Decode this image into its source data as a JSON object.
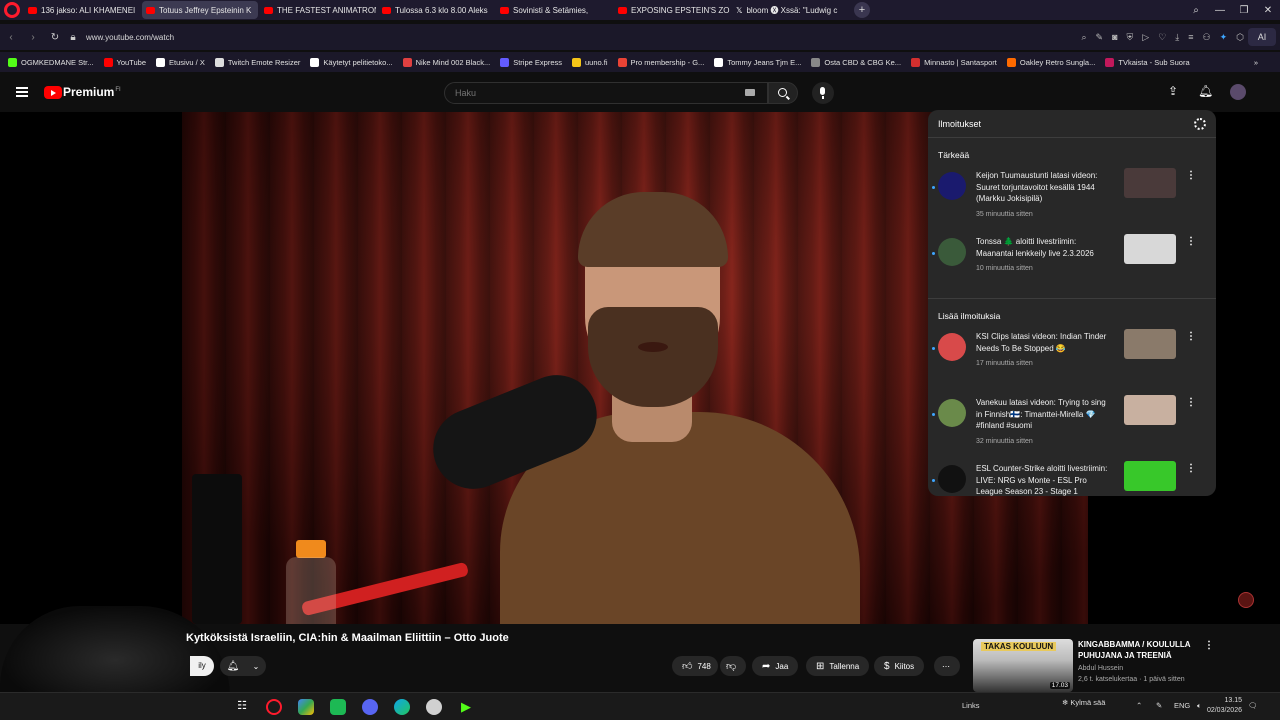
{
  "browser": {
    "tabs": [
      {
        "label": "136 jakso: ALI KHAMENEI",
        "active": false,
        "icon": "youtube-icon"
      },
      {
        "label": "Totuus Jeffrey Epsteinin K",
        "active": true,
        "icon": "youtube-icon"
      },
      {
        "label": "THE FASTEST ANIMATRONI",
        "active": false,
        "icon": "youtube-icon"
      },
      {
        "label": "Tulossa 6.3 klo 8.00 Aleks",
        "active": false,
        "icon": "youtube-icon"
      },
      {
        "label": "Sovinisti & Setämies,",
        "active": false,
        "icon": "youtube-icon"
      },
      {
        "label": "EXPOSING EPSTEIN'S ZOR",
        "active": false,
        "icon": "youtube-icon"
      },
      {
        "label": "bloom 🅧 Xssä: \"Ludwig c",
        "active": false,
        "icon": "x-icon"
      }
    ],
    "url": "www.youtube.com/watch",
    "bookmarks": [
      {
        "label": "OGMKEDMANE Str...",
        "color": "#53fc18"
      },
      {
        "label": "YouTube",
        "color": "#ff0000"
      },
      {
        "label": "Etusivu / X",
        "color": "#ffffff"
      },
      {
        "label": "Twitch Emote Resizer",
        "color": "#dddddd"
      },
      {
        "label": "Käytetyt pelitietoko...",
        "color": "#ffffff"
      },
      {
        "label": "Nike Mind 002 Black...",
        "color": "#e04040"
      },
      {
        "label": "Stripe Express",
        "color": "#635bff"
      },
      {
        "label": "uuno.fi",
        "color": "#f5c518"
      },
      {
        "label": "Pro membership - G...",
        "color": "#ea4335"
      },
      {
        "label": "Tommy Jeans Tjm E...",
        "color": "#ffffff"
      },
      {
        "label": "Osta CBD & CBG Ke...",
        "color": "#888888"
      },
      {
        "label": "Minnasto | Santasport",
        "color": "#d32f2f"
      },
      {
        "label": "Oakley Retro Sungla...",
        "color": "#ff6a00"
      },
      {
        "label": "TVkaista - Sub Suora",
        "color": "#c2185b"
      }
    ]
  },
  "youtube": {
    "brand": "Premium",
    "brand_sup": "FI",
    "search_placeholder": "Haku"
  },
  "notifications": {
    "title": "Ilmoitukset",
    "section_important": "Tärkeää",
    "section_more": "Lisää ilmoituksia",
    "important": [
      {
        "text": "Keijon Tuumaustunti latasi videon: Suuret torjuntavoitot kesällä 1944 (Markku Jokisipilä)",
        "time": "35 minuuttia sitten",
        "avatar_color": "#1a1a6e",
        "thumb_color": "#4a3a3a"
      },
      {
        "text": "Tonssa 🌲 aloitti livestriimin: Maanantai lenkkeily live 2.3.2026",
        "time": "10 minuuttia sitten",
        "avatar_color": "#3a5a3a",
        "thumb_color": "#d8d8d8"
      }
    ],
    "more": [
      {
        "text": "KSI Clips latasi videon: Indian Tinder Needs To Be Stopped 😂",
        "time": "17 minuuttia sitten",
        "avatar_color": "#d84a4a",
        "thumb_color": "#8a7a6a"
      },
      {
        "text": "Vanekuu latasi videon: Trying to sing in Finnish🇫🇮: Timanttei-Mirella 💎 #finland #suomi",
        "time": "32 minuuttia sitten",
        "avatar_color": "#6a8a4a",
        "thumb_color": "#c8b0a0"
      },
      {
        "text": "ESL Counter-Strike aloitti livestriimin: LIVE: NRG vs Monte - ESL Pro League Season 23 - Stage 1",
        "time": "",
        "avatar_color": "#111111",
        "thumb_color": "#38c82a"
      }
    ]
  },
  "video": {
    "title": "Kytköksistä Israeliin, CIA:hin & Maailman Eliittiin – Otto Juote",
    "subscribe_label": "ily",
    "likes": "748",
    "share": "Jaa",
    "save": "Tallenna",
    "thanks": "Kiitos"
  },
  "up_next": {
    "thumb_label": "TAKAS KOULUUN",
    "duration": "17.03",
    "title": "KINGABBAMMA / KOULULLA PUHUJANA JA TREENIÄ",
    "channel": "Abdul Hussein",
    "meta": "2,6 t. katselukertaa · 1 päivä sitten"
  },
  "taskbar": {
    "links": "Links",
    "weather": "Kylmä sää",
    "lang": "ENG",
    "time": "13.15",
    "date": "02/03/2026"
  }
}
